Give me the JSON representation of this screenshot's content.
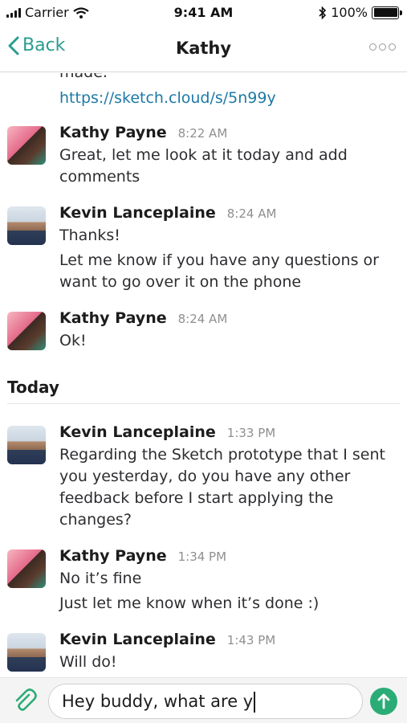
{
  "status_bar": {
    "carrier": "Carrier",
    "time": "9:41 AM",
    "battery": "100%",
    "battery_level": 1.0
  },
  "nav": {
    "back_label": "Back",
    "title": "Kathy",
    "more_icon": "more-icon"
  },
  "colors": {
    "accent": "#2a9d8f",
    "link": "#1d79a6",
    "send": "#2bac76"
  },
  "messages": {
    "cut_text": "made.",
    "link": "https://sketch.cloud/s/5n99y",
    "items": [
      {
        "author": "Kathy Payne",
        "time": "8:22 AM",
        "lines": [
          "Great, let me look at it today and add",
          "comments"
        ]
      },
      {
        "author": "Kevin Lanceplaine",
        "time": "8:24 AM",
        "lines": [
          "Thanks!",
          "Let me know if you have any questions or",
          "want to go over it on the phone"
        ]
      },
      {
        "author": "Kathy Payne",
        "time": "8:24 AM",
        "lines": [
          "Ok!"
        ]
      },
      {
        "author": "Kevin Lanceplaine",
        "time": "1:33 PM",
        "lines": [
          "Regarding the Sketch prototype that I sent",
          "you yesterday, do you have any other",
          "feedback before I start applying the",
          "changes?"
        ]
      },
      {
        "author": "Kathy Payne",
        "time": "1:34 PM",
        "lines": [
          "No it’s fine",
          "Just let me know when it’s done :)"
        ]
      },
      {
        "author": "Kevin Lanceplaine",
        "time": "1:43 PM",
        "lines": [
          "Will do!"
        ]
      }
    ]
  },
  "day_divider": "Today",
  "composer": {
    "value": "Hey buddy, what are y",
    "attach_icon": "paperclip-icon",
    "send_icon": "arrow-up-icon"
  }
}
